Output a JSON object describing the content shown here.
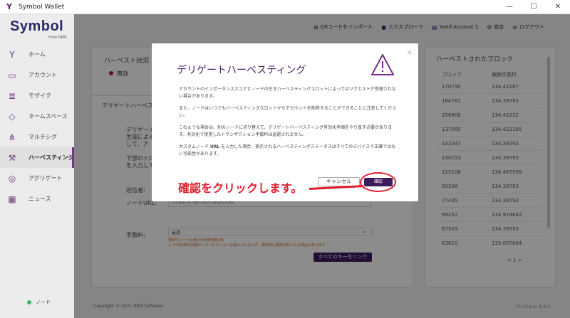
{
  "window": {
    "title": "Symbol Wallet",
    "minimize": "—",
    "maximize": "☐",
    "close": "✕"
  },
  "logo": {
    "name": "Symbol",
    "sub": "From NEM"
  },
  "topbar": {
    "qr_import": "QRコードをインポート",
    "explorer": "エクスプローラ",
    "account": "Seed Account 1",
    "settings": "設定",
    "logout": "ログアウト"
  },
  "sidebar": {
    "items": [
      {
        "label": "ホーム"
      },
      {
        "label": "アカウント"
      },
      {
        "label": "モザイク"
      },
      {
        "label": "ネームスペース"
      },
      {
        "label": "マルチシグ"
      },
      {
        "label": "ハーベスティング"
      },
      {
        "label": "アグリゲート"
      },
      {
        "label": "ニュース"
      }
    ],
    "node_label": "ノード"
  },
  "main": {
    "harvest_status_title": "ハーベスト状況",
    "status_value": "無効",
    "delegated_tab": "デリゲートハーベス",
    "bg_text1_l1": "デリゲート",
    "bg_text1_l2": "生成による",
    "bg_text1_l3": "して、ア",
    "bg_text2_l1": "下部のドロ",
    "bg_text2_l2": "を入力して",
    "sender_label": "送信者:",
    "node_url_label": "ノードURL:",
    "node_url_value": "00fabf14.xym.stir-hosyu.com",
    "fee_label": "手数料:",
    "fee_value": "最遅",
    "fee_note_l1": "選択中ノードの最小手数料倍数:45",
    "fee_note_l2": "⚠ 平均手数料未満のトランザクションは受け入れられず、最終的に期限切れになる場合があります",
    "link_all_button": "すべてのキーをリンク"
  },
  "blocks": {
    "title": "ハーベストされたブロック",
    "col_block": "ブロック",
    "col_fee": "報酬手数料",
    "rows": [
      {
        "block": "170730",
        "fee": "134.42187"
      },
      {
        "block": "164761",
        "fee": "134.39793"
      },
      {
        "block": "156900",
        "fee": "134.41032"
      },
      {
        "block": "137055",
        "fee": "134.422185"
      },
      {
        "block": "132347",
        "fee": "134.39793"
      },
      {
        "block": "130153",
        "fee": "134.39793"
      },
      {
        "block": "125108",
        "fee": "134.467908"
      },
      {
        "block": "93308",
        "fee": "134.39793"
      },
      {
        "block": "77435",
        "fee": "134.39793"
      },
      {
        "block": "69252",
        "fee": "134.919682"
      },
      {
        "block": "67503",
        "fee": "134.39793"
      },
      {
        "block": "63610",
        "fee": "135.097684"
      }
    ],
    "pager": "<   1   >"
  },
  "footer": {
    "copyright": "Copyright © 2021 NEM Software",
    "version": "バージョン: 1.0.2"
  },
  "modal": {
    "title": "デリゲートハーベスティング",
    "close": "×",
    "p1": "アカウントのインポータンススコアとノードの空きハーベスティングスロットによってはリクエストが受理されない場合があります。",
    "p2": "また、ノードはいつでもハーベスティングスロットからアカウントを削除することができることに注意してください。",
    "p3": "このような場合は、別のノードに切り替えて、デリゲートハーベスティング有効化手順をやり直す必要があります。有効化で使用したトランザクション手数料は返還されません。",
    "p4_pre": "カスタムノード ",
    "p4_bold": "URL",
    "p4_post": " を入力した場合、表示されるハーベスティングステータスはすべてのデバイスで正確ではない可能性があります。",
    "cancel_button": "キャンセル",
    "confirm_button": "確認"
  },
  "annotation": {
    "text": "確認をクリックします。",
    "color": "#e01c2c"
  }
}
